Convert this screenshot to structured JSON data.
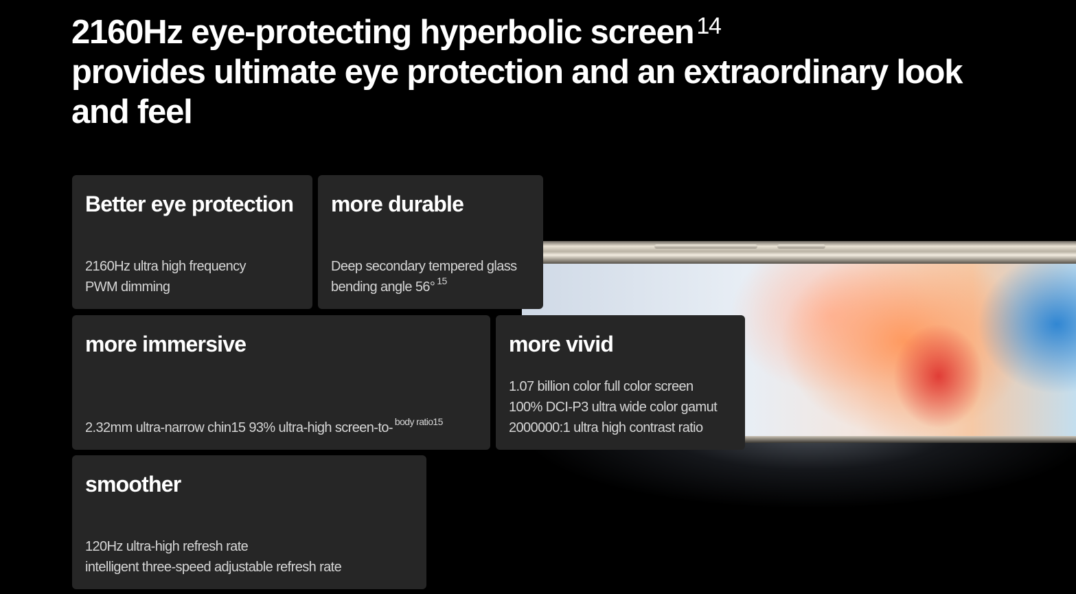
{
  "headline": {
    "line1": "2160Hz eye-protecting hyperbolic screen",
    "line1_sup": "14",
    "line2": "provides ultimate eye protection and an extraordinary look",
    "line3": "and feel"
  },
  "cards": {
    "eye": {
      "title": "Better eye protection",
      "lines": [
        "2160Hz ultra high frequency",
        "PWM dimming"
      ]
    },
    "durable": {
      "title": "more durable",
      "lines": [
        "Deep secondary tempered glass",
        "bending angle 56°"
      ],
      "sup": "15"
    },
    "immersive": {
      "title": "more immersive",
      "text": "2.32mm ultra-narrow chin15 93% ultra-high screen-to-",
      "sup": "body ratio15"
    },
    "vivid": {
      "title": "more vivid",
      "lines": [
        "1.07 billion color full color screen",
        "100% DCI-P3 ultra wide color gamut",
        "2000000:1 ultra high contrast ratio"
      ]
    },
    "smoother": {
      "title": "smoother",
      "lines": [
        "120Hz ultra-high refresh rate",
        "intelligent three-speed adjustable refresh rate"
      ]
    }
  },
  "colors": {
    "background": "#000000",
    "card_background": "#262626",
    "title_text": "#ffffff",
    "body_text": "#d6d6d6"
  }
}
